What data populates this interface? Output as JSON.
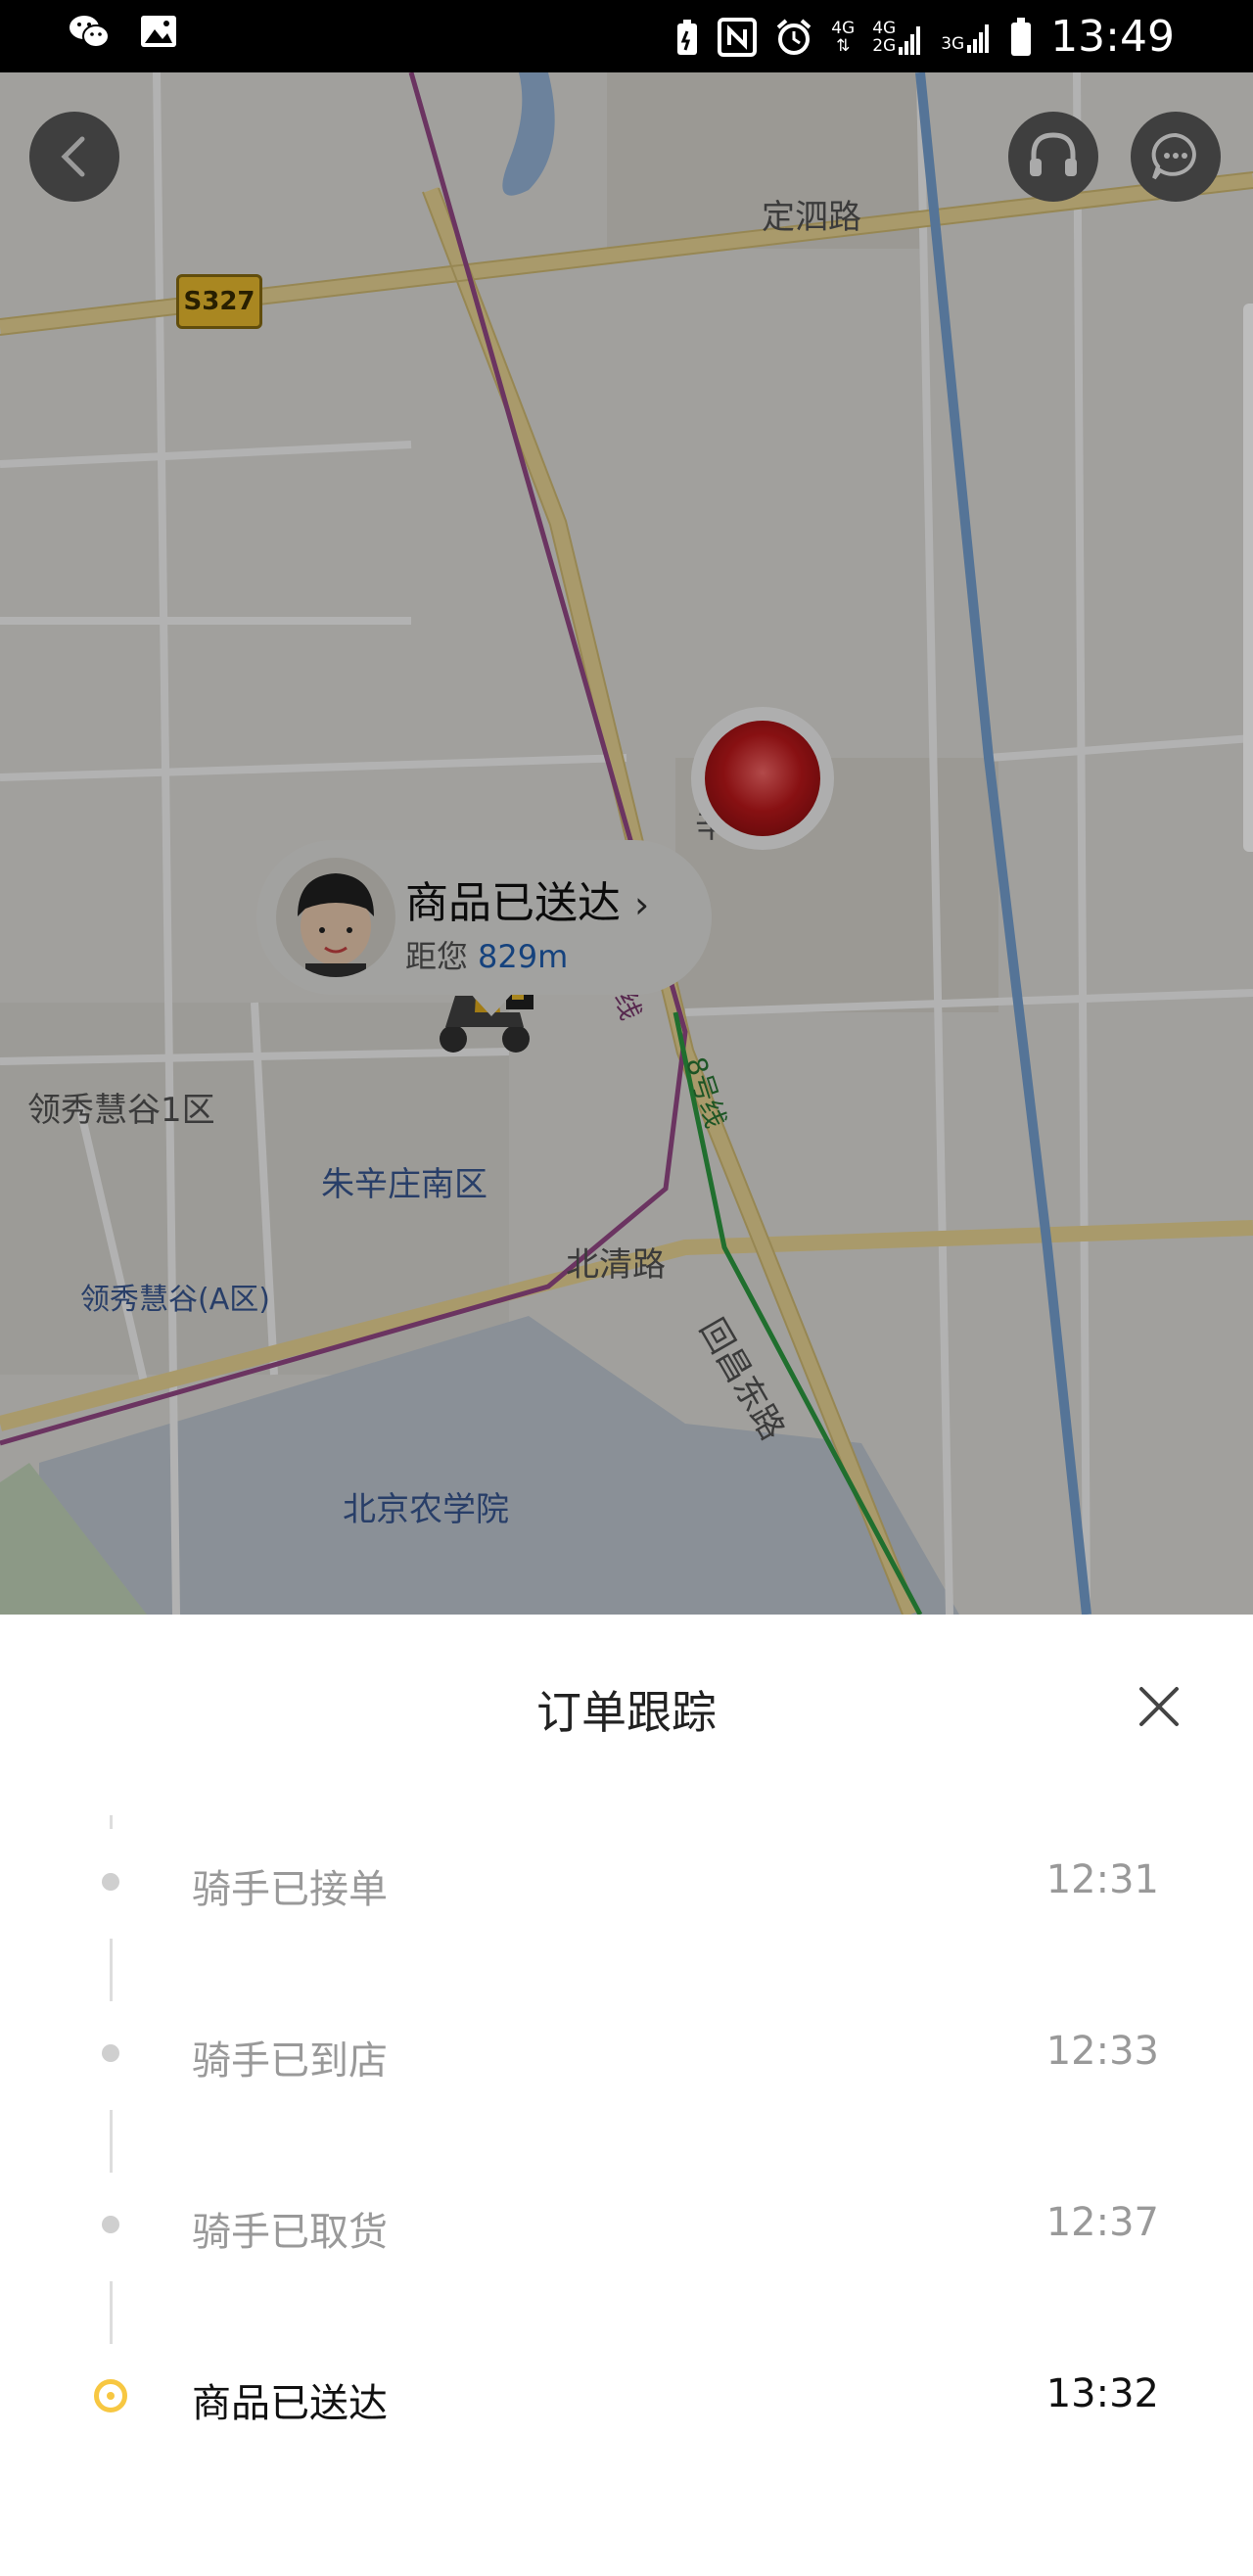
{
  "status_bar": {
    "time": "13:49",
    "net1": "4G",
    "net2a": "4G",
    "net2b": "2G",
    "net3": "3G"
  },
  "map": {
    "road_shield": "S327",
    "labels": {
      "dingsi_road": "定泗路",
      "zhuxinzhuang": "辛庄",
      "changping_line": "昌平线",
      "line8": "8号线",
      "lingxiu_1": "领秀慧谷1区",
      "zhuxinzhuang_south": "朱辛庄南区",
      "lingxiu_a": "领秀慧谷(A区)",
      "beiqing_road": "北清路",
      "huichang_east": "回昌东路",
      "bua": "北京农学院"
    },
    "rider_bubble": {
      "status": "商品已送达",
      "distance_label": "距您",
      "distance_value": "829m"
    }
  },
  "sheet": {
    "title": "订单跟踪",
    "timeline": [
      {
        "label": "骑手已接单",
        "time": "12:31",
        "active": false
      },
      {
        "label": "骑手已到店",
        "time": "12:33",
        "active": false
      },
      {
        "label": "骑手已取货",
        "time": "12:37",
        "active": false
      },
      {
        "label": "商品已送达",
        "time": "13:32",
        "active": true
      }
    ]
  },
  "colors": {
    "accent": "#f7c742",
    "distance": "#1f5fb3",
    "text_muted": "#999999",
    "text_main": "#111111"
  },
  "icons": {
    "status_left": [
      "wechat-icon",
      "gallery-icon"
    ],
    "status_right": [
      "battery-saver-icon",
      "nfc-icon",
      "alarm-icon",
      "signal-icon",
      "battery-icon"
    ],
    "map_buttons": [
      "back-icon",
      "headset-icon",
      "chat-icon"
    ]
  }
}
